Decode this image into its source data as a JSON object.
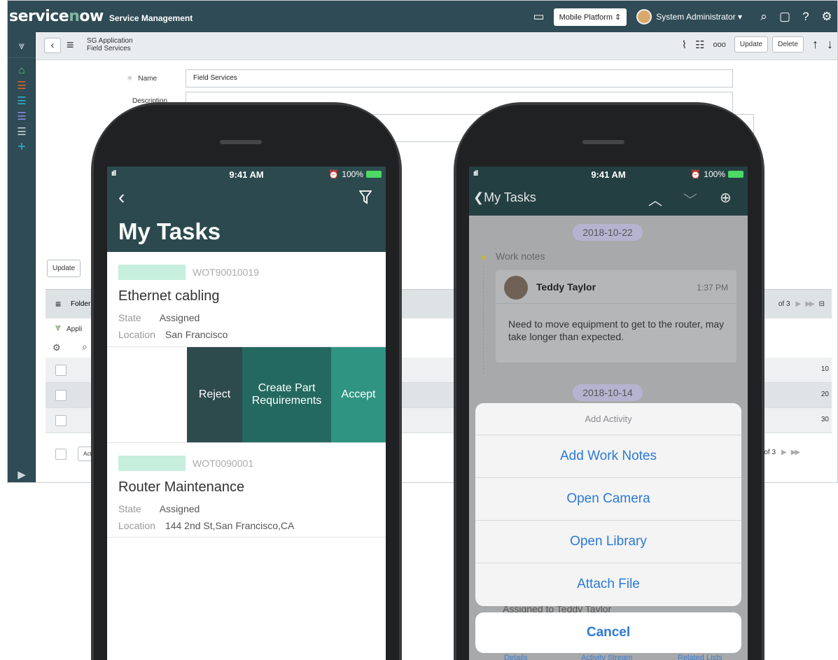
{
  "desktop": {
    "logo_text": "servicenow",
    "app_name": "Service Management",
    "perspective": "Mobile Platform",
    "user_name": "System Administrator",
    "form_header": {
      "line1": "SG Application",
      "line2": "Field Services"
    },
    "buttons": {
      "update": "Update",
      "delete": "Delete"
    },
    "fields": {
      "name_label": "Name",
      "name_value": "Field Services",
      "description_label": "Description"
    },
    "bottom_update": "Update",
    "list": {
      "header_label": "Folder",
      "filter_label": "Appli",
      "pager_text": "of 3",
      "bottom_pager_text": "1 of 3",
      "action_label": "Acti",
      "row_values": [
        "10",
        "20",
        "30"
      ]
    }
  },
  "phone1": {
    "status": {
      "time": "9:41 AM",
      "battery": "100%"
    },
    "title": "My Tasks",
    "tasks": [
      {
        "number": "WOT90010019",
        "title": "Ethernet cabling",
        "state_label": "State",
        "state": "Assigned",
        "location_label": "Location",
        "location": "San Francisco"
      },
      {
        "number": "WOT0090001",
        "title": "Router Maintenance",
        "state_label": "State",
        "state": "Assigned",
        "location_label": "Location",
        "location": "144 2nd St,San Francisco,CA"
      }
    ],
    "swipe_actions": {
      "reject": "Reject",
      "create_part": "Create Part Requirements",
      "accept": "Accept"
    }
  },
  "phone2": {
    "status": {
      "time": "9:41 AM",
      "battery": "100%"
    },
    "title": "My Tasks",
    "dates": [
      "2018-10-22",
      "2018-10-14"
    ],
    "work_notes_label": "Work notes",
    "note": {
      "author": "Teddy Taylor",
      "time": "1:37 PM",
      "text": "Need to move equipment to get to the router, may take longer than expected."
    },
    "behind_text": "Assigned to  Teddy Taylor",
    "tabs": [
      "Details",
      "Activity Stream",
      "Related Lists"
    ],
    "sheet": {
      "title": "Add Activity",
      "items": [
        "Add Work Notes",
        "Open Camera",
        "Open Library",
        "Attach File"
      ],
      "cancel": "Cancel"
    }
  },
  "colors": {
    "header_bg": "#2f4b55",
    "mobile_header": "#2c4a4e",
    "accent_green": "#81b5a1",
    "ios_blue": "#2a7ad6"
  }
}
